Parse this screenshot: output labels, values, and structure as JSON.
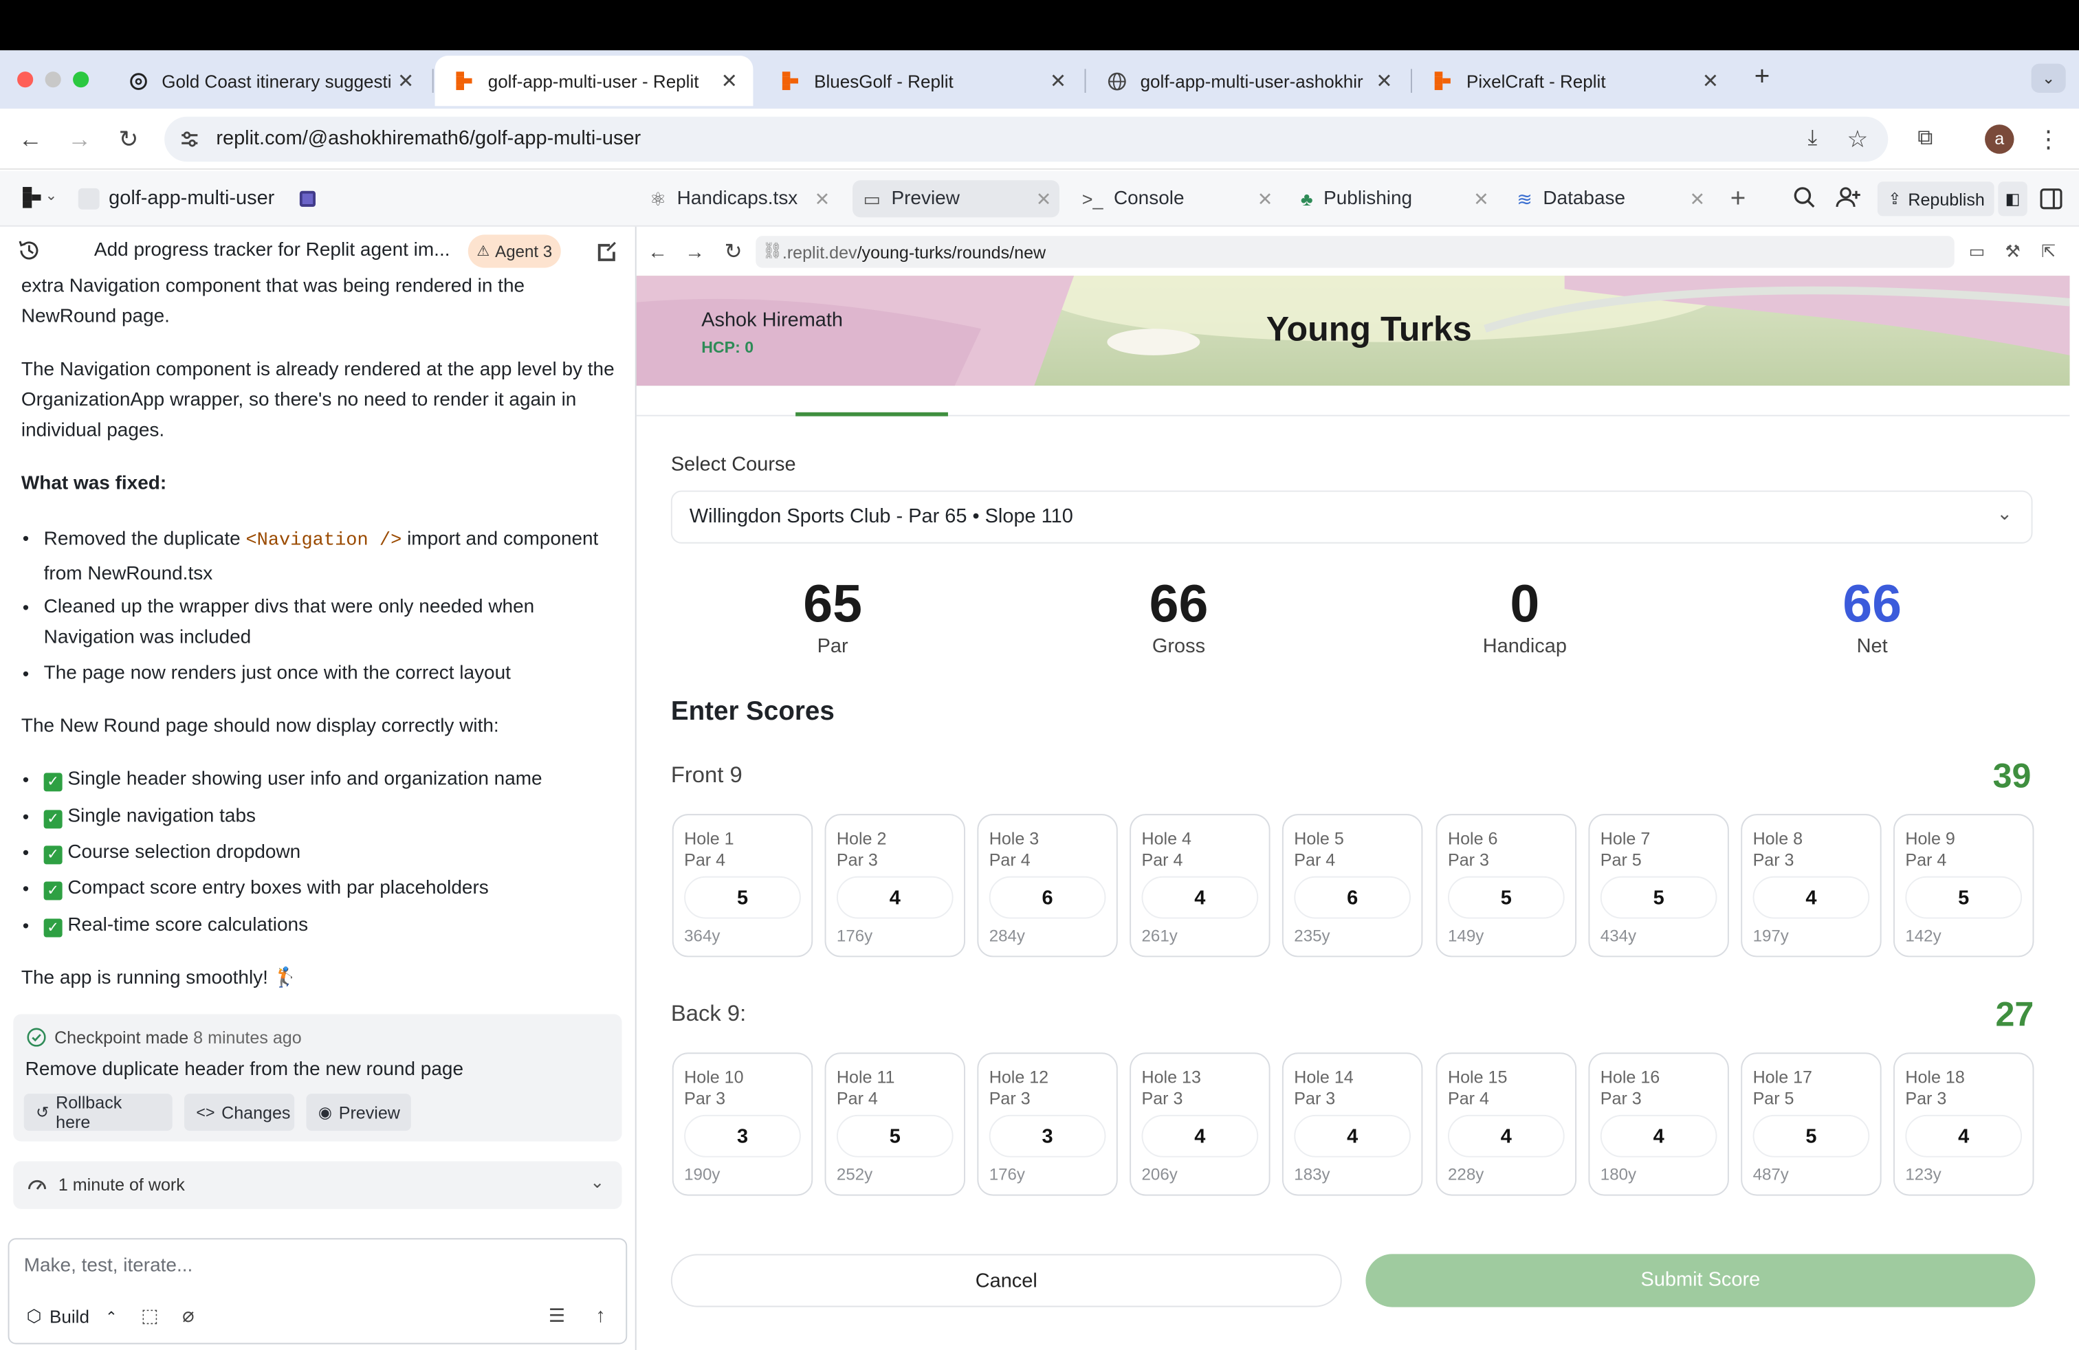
{
  "browser": {
    "tabs": [
      {
        "label": "Gold Coast itinerary suggesti",
        "icon": "openai-icon"
      },
      {
        "label": "golf-app-multi-user - Replit",
        "icon": "replit-icon",
        "active": true
      },
      {
        "label": "BluesGolf - Replit",
        "icon": "replit-icon"
      },
      {
        "label": "golf-app-multi-user-ashokhir",
        "icon": "globe-icon"
      },
      {
        "label": "PixelCraft - Replit",
        "icon": "replit-icon"
      }
    ],
    "url": "replit.com/@ashokhiremath6/golf-app-multi-user",
    "profile_initial": "a"
  },
  "workspace": {
    "project_name": "golf-app-multi-user",
    "tabs": [
      {
        "label": "Handicaps.tsx"
      },
      {
        "label": "Preview",
        "active": true
      },
      {
        "label": "Console"
      },
      {
        "label": "Publishing"
      },
      {
        "label": "Database"
      }
    ],
    "republish_label": "Republish"
  },
  "chat": {
    "thread_title": "Add progress tracker for Replit agent im...",
    "agent_badge": "Agent 3",
    "p1": "extra Navigation component that was being rendered in the NewRound page.",
    "p2": "The Navigation component is already rendered at the app level by the OrganizationApp wrapper, so there's no need to render it again in individual pages.",
    "fixed_heading": "What was fixed:",
    "fix1_pre": "Removed the duplicate ",
    "fix1_code": "<Navigation />",
    "fix1_post": " import and component from NewRound.tsx",
    "fix2": "Cleaned up the wrapper divs that were only needed when Navigation was included",
    "fix3": "The page now renders just once with the correct layout",
    "p3": "The New Round page should now display correctly with:",
    "checks": [
      "Single header showing user info and organization name",
      "Single navigation tabs",
      "Course selection dropdown",
      "Compact score entry boxes with par placeholders",
      "Real-time score calculations"
    ],
    "p4": "The app is running smoothly! 🏌",
    "checkpoint_label": "Checkpoint made",
    "checkpoint_time": "8 minutes ago",
    "checkpoint_desc": "Remove duplicate header from the new round page",
    "rollback_label": "Rollback here",
    "changes_label": "Changes",
    "preview_label": "Preview",
    "work_label": "1 minute of work",
    "input_placeholder": "Make, test, iterate...",
    "build_label": "Build"
  },
  "preview": {
    "url_domain": ".replit.dev",
    "url_path": "/young-turks/rounds/new",
    "user_name": "Ashok Hiremath",
    "hcp_text": "HCP: 0",
    "org_name": "Young Turks",
    "select_course_label": "Select Course",
    "course_value": "Willingdon Sports Club - Par 65 • Slope 110",
    "stats": [
      {
        "value": "65",
        "label": "Par"
      },
      {
        "value": "66",
        "label": "Gross"
      },
      {
        "value": "0",
        "label": "Handicap"
      },
      {
        "value": "66",
        "label": "Net"
      }
    ],
    "enter_scores": "Enter Scores",
    "front_label": "Front 9",
    "front_total": "39",
    "back_label": "Back 9:",
    "back_total": "27",
    "holes": [
      {
        "hole": "Hole 1",
        "par": "Par 4",
        "score": "5",
        "yards": "364y"
      },
      {
        "hole": "Hole 2",
        "par": "Par 3",
        "score": "4",
        "yards": "176y"
      },
      {
        "hole": "Hole 3",
        "par": "Par 4",
        "score": "6",
        "yards": "284y"
      },
      {
        "hole": "Hole 4",
        "par": "Par 4",
        "score": "4",
        "yards": "261y"
      },
      {
        "hole": "Hole 5",
        "par": "Par 4",
        "score": "6",
        "yards": "235y"
      },
      {
        "hole": "Hole 6",
        "par": "Par 3",
        "score": "5",
        "yards": "149y"
      },
      {
        "hole": "Hole 7",
        "par": "Par 5",
        "score": "5",
        "yards": "434y"
      },
      {
        "hole": "Hole 8",
        "par": "Par 3",
        "score": "4",
        "yards": "197y"
      },
      {
        "hole": "Hole 9",
        "par": "Par 4",
        "score": "5",
        "yards": "142y"
      },
      {
        "hole": "Hole 10",
        "par": "Par 3",
        "score": "3",
        "yards": "190y"
      },
      {
        "hole": "Hole 11",
        "par": "Par 4",
        "score": "5",
        "yards": "252y"
      },
      {
        "hole": "Hole 12",
        "par": "Par 3",
        "score": "3",
        "yards": "176y"
      },
      {
        "hole": "Hole 13",
        "par": "Par 3",
        "score": "4",
        "yards": "206y"
      },
      {
        "hole": "Hole 14",
        "par": "Par 3",
        "score": "4",
        "yards": "183y"
      },
      {
        "hole": "Hole 15",
        "par": "Par 4",
        "score": "4",
        "yards": "228y"
      },
      {
        "hole": "Hole 16",
        "par": "Par 3",
        "score": "4",
        "yards": "180y"
      },
      {
        "hole": "Hole 17",
        "par": "Par 5",
        "score": "5",
        "yards": "487y"
      },
      {
        "hole": "Hole 18",
        "par": "Par 3",
        "score": "4",
        "yards": "123y"
      }
    ],
    "cancel_label": "Cancel",
    "submit_label": "Submit Score"
  },
  "colors": {
    "net_blue": "#3b5bdb",
    "green_total": "#3f8f3f",
    "submit_green": "#9fcb9f",
    "agent_badge_bg": "#fde3cf"
  }
}
